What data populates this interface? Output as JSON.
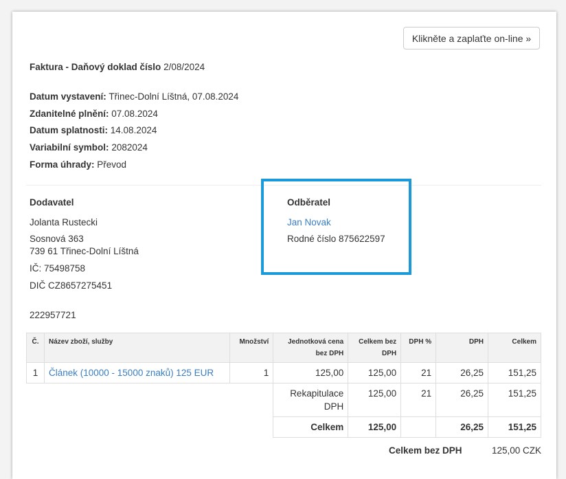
{
  "pay_button": "Klikněte a zaplaťte on-line »",
  "invoice": {
    "title_prefix": "Faktura - Daňový doklad číslo",
    "number": "2/08/2024"
  },
  "meta": [
    {
      "label": "Datum vystavení:",
      "value": "Třinec-Dolní Líštná, 07.08.2024"
    },
    {
      "label": "Zdanitelné plnění:",
      "value": "07.08.2024"
    },
    {
      "label": "Datum splatnosti:",
      "value": "14.08.2024"
    },
    {
      "label": "Variabilní symbol:",
      "value": "2082024"
    },
    {
      "label": "Forma úhrady:",
      "value": "Převod"
    }
  ],
  "supplier": {
    "heading": "Dodavatel",
    "name": "Jolanta Rustecki",
    "street": "Sosnová 363",
    "city": "739 61 Třinec-Dolní Líštná",
    "ic": "IČ: 75498758",
    "dic": "DIČ CZ8657275451",
    "account": "222957721"
  },
  "customer": {
    "heading": "Odběratel",
    "name": "Jan Novak",
    "birth_number": "Rodné číslo 875622597"
  },
  "table": {
    "headers": {
      "no": "Č.",
      "name": "Název zboží, služby",
      "qty": "Množství",
      "unit_price": "Jednotková cena bez DPH",
      "total_wo_vat": "Celkem bez DPH",
      "vat_pct": "DPH %",
      "vat": "DPH",
      "total": "Celkem"
    },
    "rows": [
      {
        "no": "1",
        "name": "Článek (10000 - 15000 znaků) 125 EUR",
        "qty": "1",
        "unit_price": "125,00",
        "total_wo_vat": "125,00",
        "vat_pct": "21",
        "vat": "26,25",
        "total": "151,25"
      }
    ],
    "recap": {
      "label": "Rekapitulace DPH",
      "total_wo_vat": "125,00",
      "vat_pct": "21",
      "vat": "26,25",
      "total": "151,25"
    },
    "sum": {
      "label": "Celkem",
      "total_wo_vat": "125,00",
      "vat": "26,25",
      "total": "151,25"
    }
  },
  "summary": {
    "label": "Celkem bez DPH",
    "value": "125,00 CZK"
  },
  "colors": {
    "link": "#3a7ec2",
    "highlight_border": "#1a9ad9"
  }
}
